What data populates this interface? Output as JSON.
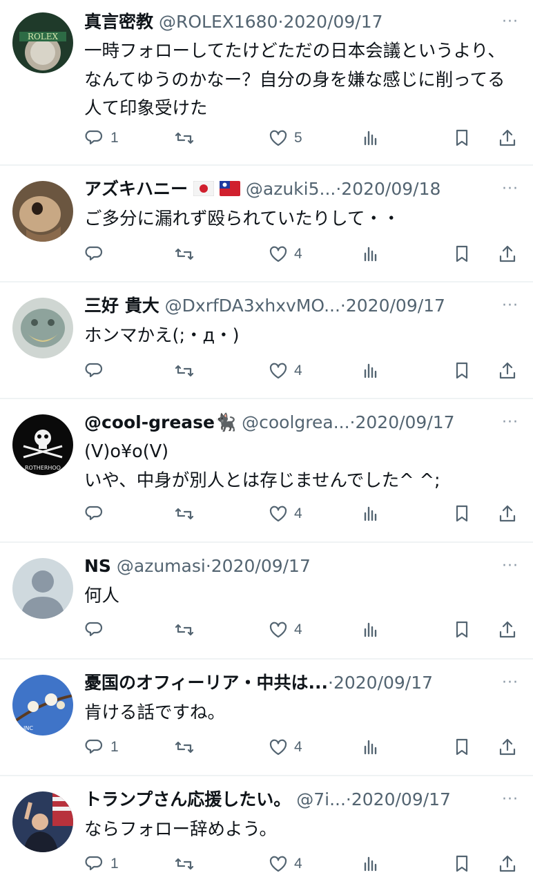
{
  "tweets": [
    {
      "name": "真言密教",
      "handle": "@ROLEX1680",
      "sep": "·",
      "date": "2020/09/17",
      "text": "一時フォローしてたけどただの日本会議というより、なんてゆうのかなー？自分の身を嫌な感じに削ってる人て印象受けた",
      "reply_count": "1",
      "retweet_count": "",
      "like_count": "5",
      "avatar_text": "ROLEX"
    },
    {
      "name": "アズキハニー",
      "flags": [
        "japan-flag",
        "taiwan-flag"
      ],
      "handle": "@azuki5...",
      "sep": "·",
      "date": "2020/09/18",
      "text": "ご多分に漏れず殴られていたりして・・",
      "reply_count": "",
      "retweet_count": "",
      "like_count": "4"
    },
    {
      "name": "三好 貴大",
      "handle": "@DxrfDA3xhxvMO...",
      "sep": "·",
      "date": "2020/09/17",
      "text": "ホンマかえ(;・д・)",
      "reply_count": "",
      "retweet_count": "",
      "like_count": "4"
    },
    {
      "name": "@cool-grease",
      "name_emoji": "🐈‍⬛",
      "handle": "@coolgrea...",
      "sep": "·",
      "date": "2020/09/17",
      "text": "(V)o¥o(V)\nいや、中身が別人とは存じませんでした^ ^;",
      "reply_count": "",
      "retweet_count": "",
      "like_count": "4",
      "avatar_text": "ROTHERHOO"
    },
    {
      "name": "NS",
      "handle": "@azumasi",
      "sep": "·",
      "date": "2020/09/17",
      "text": "何人",
      "reply_count": "",
      "retweet_count": "",
      "like_count": "4"
    },
    {
      "name": "憂国のオフィーリア・中共は...",
      "handle": "",
      "sep": "·",
      "date": "2020/09/17",
      "text": "肯ける話ですね。",
      "reply_count": "1",
      "retweet_count": "",
      "like_count": "4",
      "avatar_text": "INC"
    },
    {
      "name": "トランプさん応援したい。",
      "handle": "@7i...",
      "sep": "·",
      "date": "2020/09/17",
      "text": "ならフォロー辞めよう。",
      "reply_count": "1",
      "retweet_count": "",
      "like_count": "4"
    }
  ],
  "more_glyph": "···",
  "colors": {
    "text": "#0f1419",
    "secondary": "#536471",
    "divider": "#eff3f4"
  }
}
